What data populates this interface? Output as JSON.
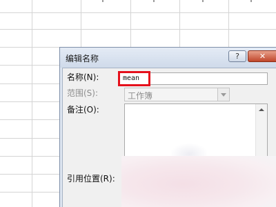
{
  "dialog": {
    "title": "编辑名称",
    "help_button": "?",
    "close_button": "✕",
    "name_label": "名称(N):",
    "name_value": "mean",
    "scope_label": "范围(S):",
    "scope_value": "工作簿",
    "comment_label": "备注(O):",
    "refers_to_label": "引用位置(R):"
  },
  "colors": {
    "highlight": "#e5101b",
    "titlebar": "#d6e0ee"
  }
}
